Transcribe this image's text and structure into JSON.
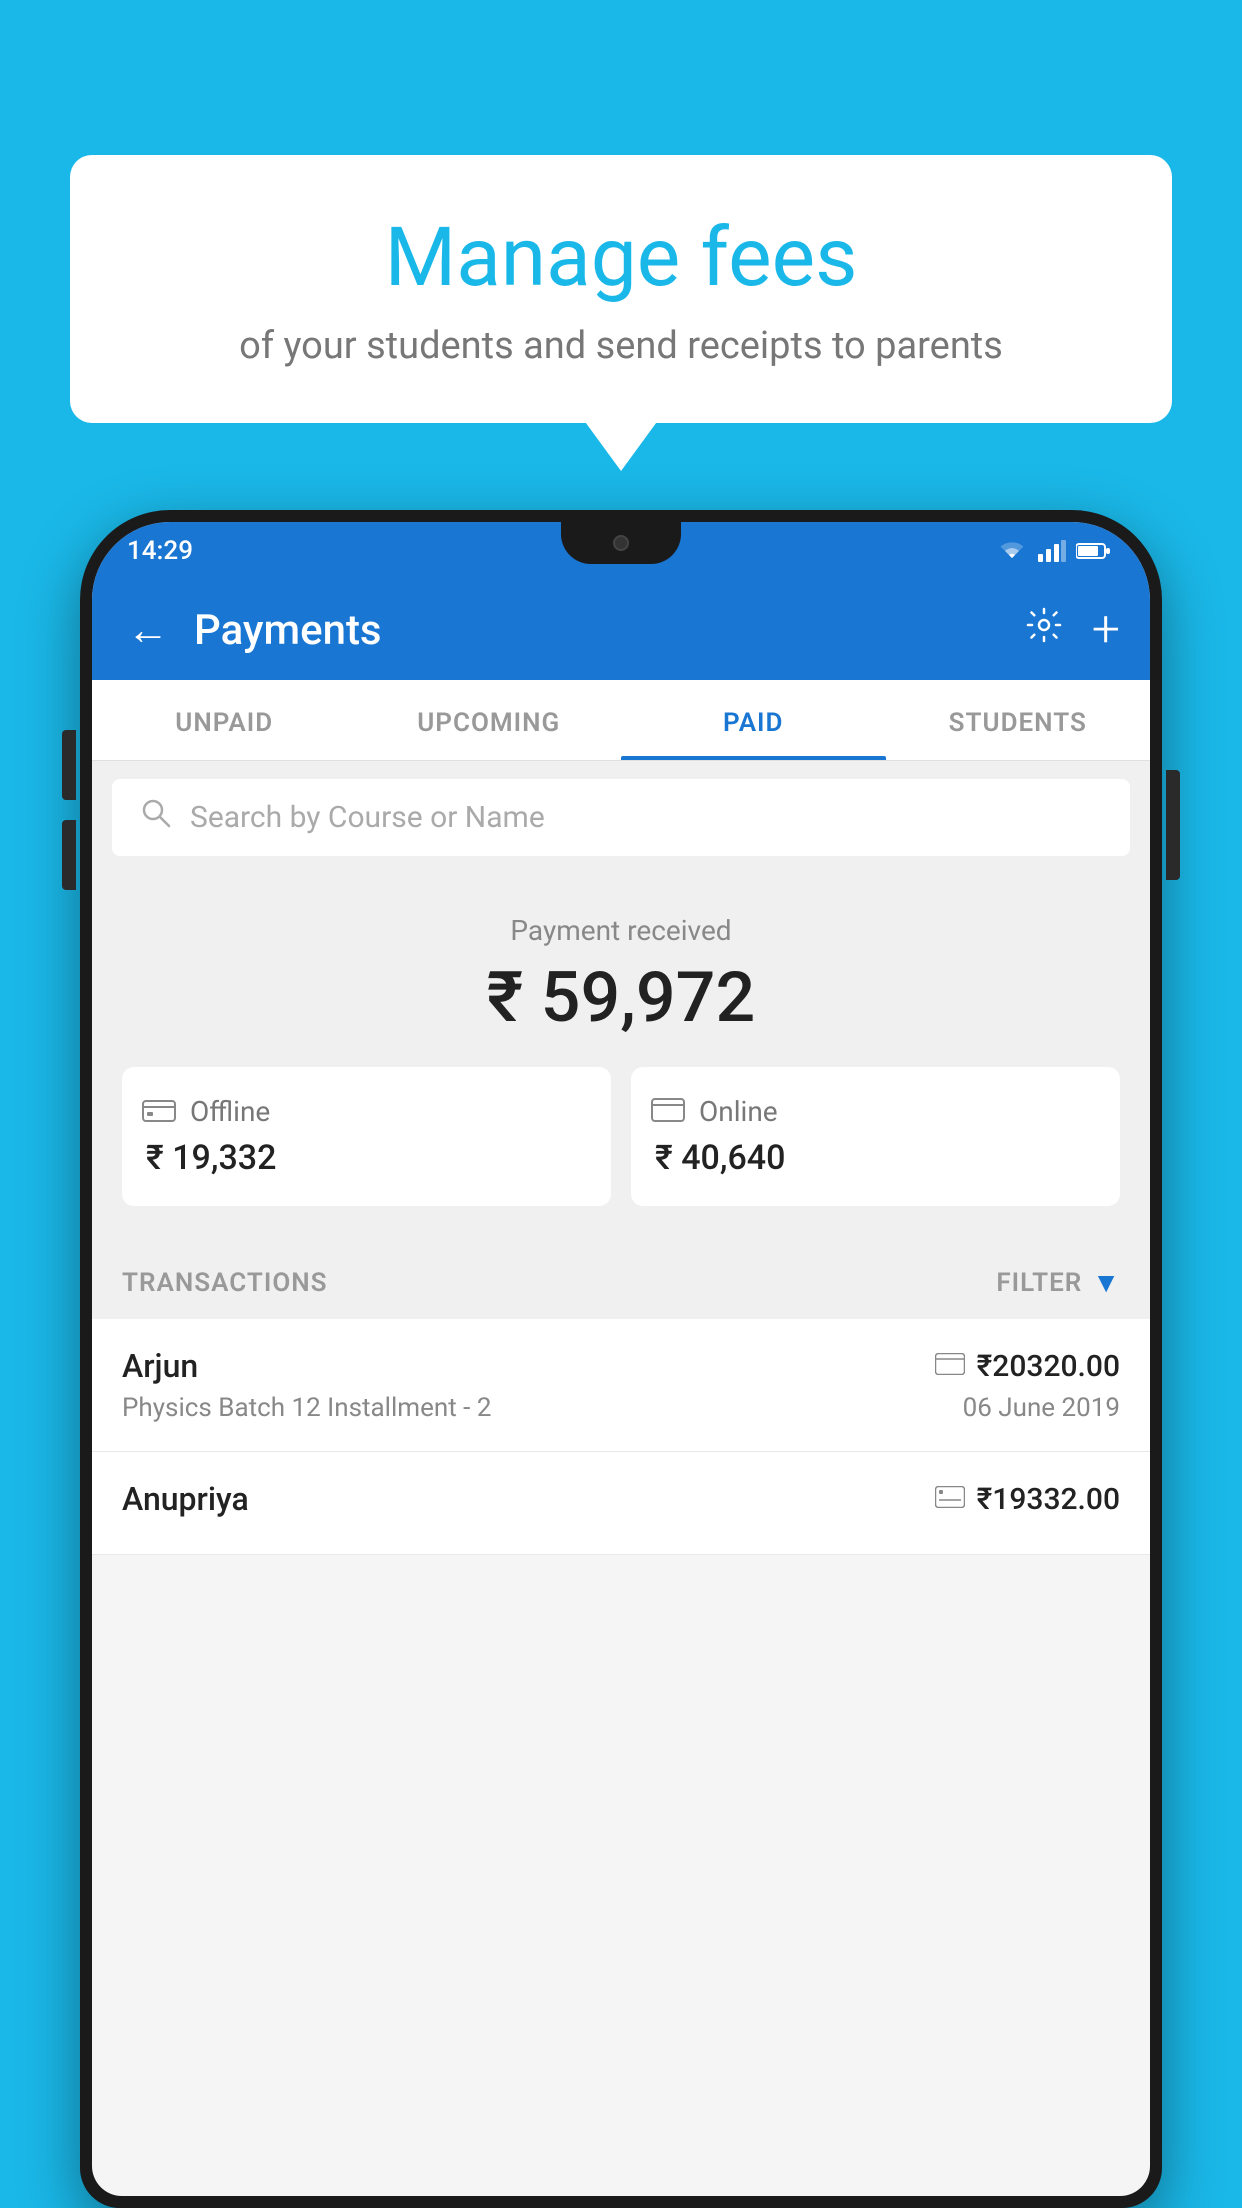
{
  "background_color": "#1ab8e8",
  "bubble": {
    "title": "Manage fees",
    "subtitle": "of your students and send receipts to parents"
  },
  "status_bar": {
    "time": "14:29"
  },
  "app_bar": {
    "title": "Payments",
    "back_label": "←",
    "gear_label": "⚙",
    "plus_label": "+"
  },
  "tabs": [
    {
      "label": "UNPAID",
      "active": false
    },
    {
      "label": "UPCOMING",
      "active": false
    },
    {
      "label": "PAID",
      "active": true
    },
    {
      "label": "STUDENTS",
      "active": false
    }
  ],
  "search": {
    "placeholder": "Search by Course or Name"
  },
  "payment_section": {
    "label": "Payment received",
    "amount": "₹ 59,972",
    "offline": {
      "icon": "💳",
      "label": "Offline",
      "amount": "₹ 19,332"
    },
    "online": {
      "icon": "💳",
      "label": "Online",
      "amount": "₹ 40,640"
    }
  },
  "transactions_header": {
    "label": "TRANSACTIONS",
    "filter_label": "FILTER"
  },
  "transactions": [
    {
      "name": "Arjun",
      "type_icon": "💳",
      "amount": "₹20320.00",
      "description": "Physics Batch 12 Installment - 2",
      "date": "06 June 2019"
    },
    {
      "name": "Anupriya",
      "type_icon": "💴",
      "amount": "₹19332.00",
      "description": "",
      "date": ""
    }
  ]
}
